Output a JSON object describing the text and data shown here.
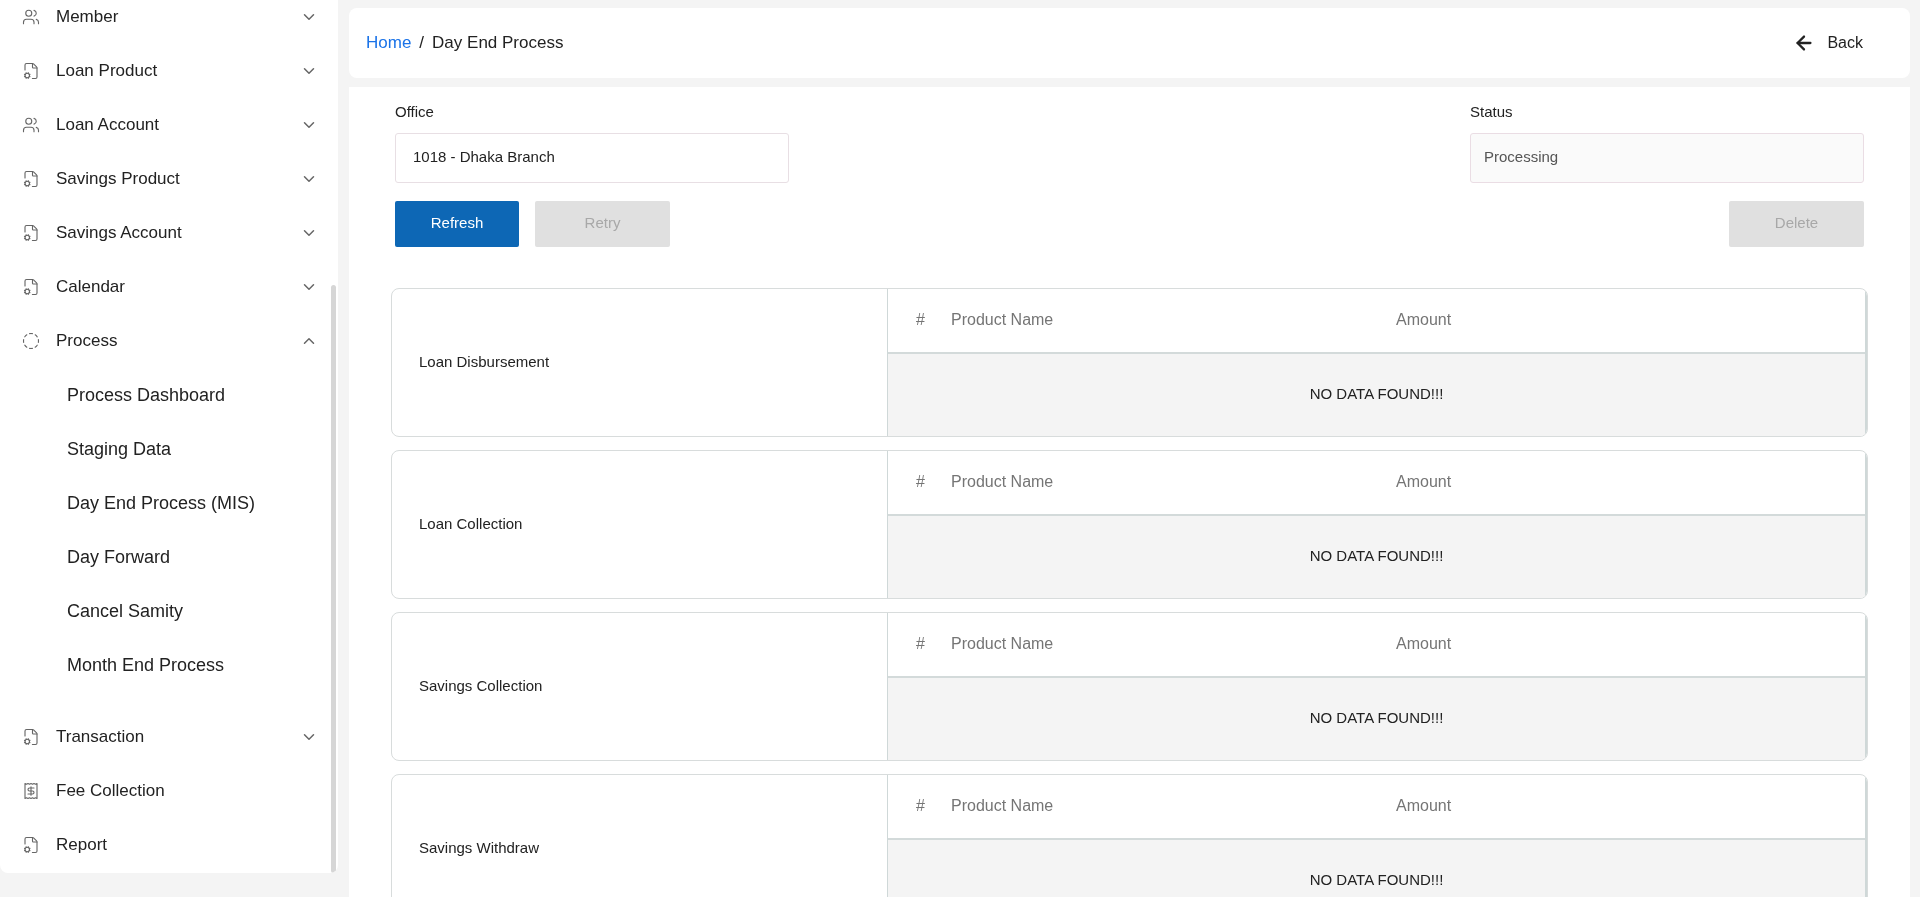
{
  "sidebar": {
    "items": [
      {
        "label": "Member",
        "kind": "people",
        "expanded": false
      },
      {
        "label": "Loan Product",
        "kind": "document",
        "expanded": false
      },
      {
        "label": "Loan Account",
        "kind": "people",
        "expanded": false
      },
      {
        "label": "Savings Product",
        "kind": "document",
        "expanded": false
      },
      {
        "label": "Savings Account",
        "kind": "document",
        "expanded": false
      },
      {
        "label": "Calendar",
        "kind": "document",
        "expanded": false
      },
      {
        "label": "Process",
        "kind": "process",
        "expanded": true,
        "children": [
          {
            "label": "Process Dashboard"
          },
          {
            "label": "Staging Data"
          },
          {
            "label": "Day End Process (MIS)"
          },
          {
            "label": "Day Forward"
          },
          {
            "label": "Cancel Samity"
          },
          {
            "label": "Month End Process"
          }
        ]
      },
      {
        "label": "Transaction",
        "kind": "document",
        "expanded": false
      },
      {
        "label": "Fee Collection",
        "kind": "fee"
      },
      {
        "label": "Report",
        "kind": "document"
      }
    ]
  },
  "breadcrumb": {
    "link": "Home",
    "separator": "/",
    "current": "Day End Process"
  },
  "back_button": "Back",
  "form": {
    "office": {
      "label": "Office",
      "value": "1018 - Dhaka Branch"
    },
    "status": {
      "label": "Status",
      "value": "Processing"
    }
  },
  "buttons": [
    {
      "label": "Refresh",
      "disabled": false
    },
    {
      "label": "Retry",
      "disabled": true
    },
    {
      "label": "Delete",
      "disabled": true
    }
  ],
  "sections": [
    {
      "title": "Loan Disbursement",
      "columns": [
        "#",
        "Product Name",
        "Amount"
      ],
      "empty_message": "NO DATA FOUND!!!"
    },
    {
      "title": "Loan Collection",
      "columns": [
        "#",
        "Product Name",
        "Amount"
      ],
      "empty_message": "NO DATA FOUND!!!"
    },
    {
      "title": "Savings Collection",
      "columns": [
        "#",
        "Product Name",
        "Amount"
      ],
      "empty_message": "NO DATA FOUND!!!"
    },
    {
      "title": "Savings Withdraw",
      "columns": [
        "#",
        "Product Name",
        "Amount"
      ],
      "empty_message": "NO DATA FOUND!!!"
    }
  ]
}
